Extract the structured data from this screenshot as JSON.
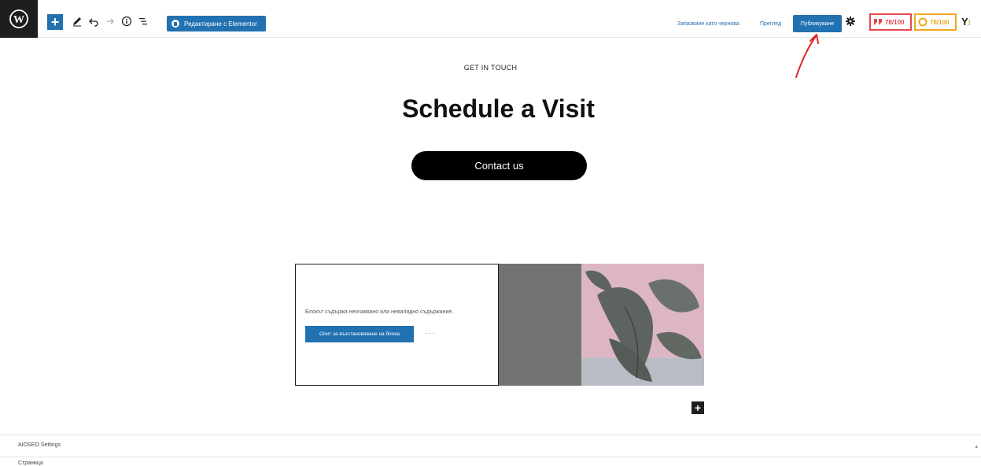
{
  "toolbar": {
    "elementor_label": "Редактиране с Elementor",
    "save_draft": "Запазване като чернова",
    "preview": "Преглед",
    "publish": "Публикуване",
    "score_red": "78/100",
    "score_orange": "78/100",
    "yoast_logo": "Y"
  },
  "content": {
    "eyebrow": "GET IN TOUCH",
    "headline": "Schedule a Visit",
    "cta": "Contact us"
  },
  "block_warning": {
    "message": "Блокът съдържа неочаквано или невалидно съдържание.",
    "recover": "Опит за възстановяване на блока",
    "more": "···"
  },
  "meta": {
    "aioseo": "AIOSEO Settings",
    "page": "Страница"
  },
  "colors": {
    "accent": "#2271b1",
    "annotation": "#e02424",
    "plant_bg": "#dcb6c5",
    "gray_panel": "#707370"
  }
}
